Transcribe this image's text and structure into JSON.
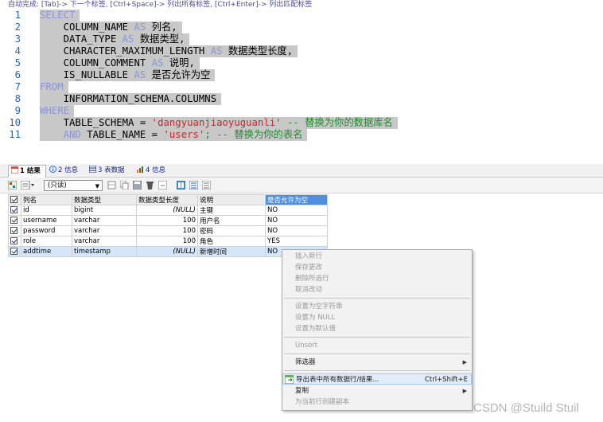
{
  "editor": {
    "autocomplete_hint": "自动完成: [Tab]-> 下一个标签, [Ctrl+Space]-> 列出所有标签, [Ctrl+Enter]-> 列出匹配标签",
    "lines": [
      {
        "no": "1",
        "parts": [
          {
            "t": "SELECT",
            "c": "kw"
          }
        ]
      },
      {
        "no": "2",
        "parts": [
          {
            "t": "    COLUMN_NAME ",
            "c": "pl"
          },
          {
            "t": "AS",
            "c": "kw"
          },
          {
            "t": " 列名,",
            "c": "pl"
          }
        ]
      },
      {
        "no": "3",
        "parts": [
          {
            "t": "    DATA_TYPE ",
            "c": "pl"
          },
          {
            "t": "AS",
            "c": "kw"
          },
          {
            "t": " 数据类型,",
            "c": "pl"
          }
        ]
      },
      {
        "no": "4",
        "parts": [
          {
            "t": "    CHARACTER_MAXIMUM_LENGTH ",
            "c": "pl"
          },
          {
            "t": "AS",
            "c": "kw"
          },
          {
            "t": " 数据类型长度,",
            "c": "pl"
          }
        ]
      },
      {
        "no": "5",
        "parts": [
          {
            "t": "    COLUMN_COMMENT ",
            "c": "pl"
          },
          {
            "t": "AS",
            "c": "kw"
          },
          {
            "t": " 说明,",
            "c": "pl"
          }
        ]
      },
      {
        "no": "6",
        "parts": [
          {
            "t": "    IS_NULLABLE ",
            "c": "pl"
          },
          {
            "t": "AS",
            "c": "kw"
          },
          {
            "t": " 是否允许为空",
            "c": "pl"
          }
        ]
      },
      {
        "no": "7",
        "parts": [
          {
            "t": "FROM",
            "c": "kw"
          }
        ]
      },
      {
        "no": "8",
        "parts": [
          {
            "t": "    INFORMATION_SCHEMA.COLUMNS",
            "c": "pl"
          }
        ]
      },
      {
        "no": "9",
        "parts": [
          {
            "t": "WHERE",
            "c": "kw"
          }
        ]
      },
      {
        "no": "10",
        "parts": [
          {
            "t": "    TABLE_SCHEMA = ",
            "c": "pl"
          },
          {
            "t": "'dangyuanjiaoyuguanli'",
            "c": "str"
          },
          {
            "t": " -- 替换为你的数据库名",
            "c": "cm"
          }
        ]
      },
      {
        "no": "11",
        "parts": [
          {
            "t": "    ",
            "c": "pl"
          },
          {
            "t": "AND",
            "c": "kw"
          },
          {
            "t": " TABLE_NAME = ",
            "c": "pl"
          },
          {
            "t": "'users'",
            "c": "str"
          },
          {
            "t": "; -- 替换为你的表名",
            "c": "cm"
          }
        ]
      }
    ]
  },
  "tabs": [
    {
      "label": "1 结果",
      "icon": "table-result-icon",
      "active": true
    },
    {
      "label": "2 信息",
      "icon": "info-icon",
      "active": false
    },
    {
      "label": "3 表数据",
      "icon": "table-data-icon",
      "active": false
    },
    {
      "label": "4 信息",
      "icon": "chart-info-icon",
      "active": false
    }
  ],
  "toolbar": {
    "mode_select": "(只读)",
    "icons": [
      "grid-view-icon",
      "filter-dropdown-icon",
      "export-icon",
      "copy-icon",
      "save-icon",
      "delete-icon",
      "refresh-icon",
      "form-view-icon",
      "text-view-icon",
      "columns-view-icon"
    ]
  },
  "grid": {
    "headers": [
      "列名",
      "数据类型",
      "数据类型长度",
      "说明",
      "是否允许为空"
    ],
    "rows": [
      [
        "id",
        "bigint",
        "(NULL)",
        "主键",
        "NO"
      ],
      [
        "username",
        "varchar",
        "100",
        "用户名",
        "NO"
      ],
      [
        "password",
        "varchar",
        "100",
        "密码",
        "NO"
      ],
      [
        "role",
        "varchar",
        "100",
        "角色",
        "YES"
      ],
      [
        "addtime",
        "timestamp",
        "(NULL)",
        "新增时间",
        "NO"
      ]
    ]
  },
  "context_menu": {
    "items": [
      {
        "label": "插入新行",
        "enabled": false
      },
      {
        "label": "保存更改",
        "enabled": false
      },
      {
        "label": "删除所选行",
        "enabled": false
      },
      {
        "label": "取消改动",
        "enabled": false
      },
      {
        "sep": true
      },
      {
        "label": "设置为空字符串",
        "enabled": false
      },
      {
        "label": "设置为 NULL",
        "enabled": false
      },
      {
        "label": "设置为默认值",
        "enabled": false
      },
      {
        "sep": true
      },
      {
        "label": "Unsort",
        "enabled": false
      },
      {
        "sep": true
      },
      {
        "label": "筛选器",
        "enabled": true,
        "submenu": true
      },
      {
        "sep": true
      },
      {
        "label": "导出表中所有数据行/结果...",
        "enabled": true,
        "shortcut": "Ctrl+Shift+E",
        "hover": true
      },
      {
        "label": "复制",
        "enabled": true,
        "submenu": true
      },
      {
        "label": "为当前行创建副本",
        "enabled": false
      }
    ]
  },
  "watermark": "CSDN @Stuild Stuil",
  "colors": {
    "keyword": "#8a95d8",
    "string": "#c62828",
    "comment": "#1f8a2c",
    "line_number": "#2c62b5",
    "selection": "#c8c8c8",
    "header_highlight": "#4f8fdc"
  }
}
